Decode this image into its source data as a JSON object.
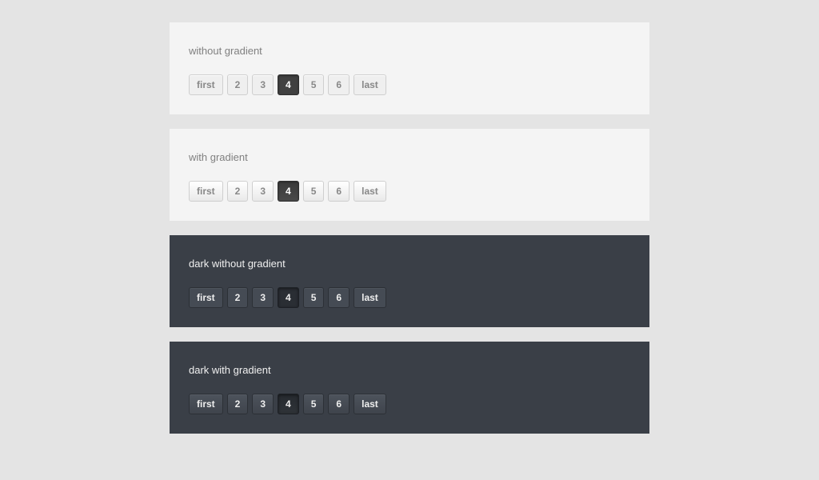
{
  "sections": [
    {
      "variant": "light",
      "title": "without gradient",
      "active": "4"
    },
    {
      "variant": "light grad",
      "title": "with gradient",
      "active": "4"
    },
    {
      "variant": "dark",
      "title": "dark without gradient",
      "active": "4"
    },
    {
      "variant": "dark grad",
      "title": "dark with gradient",
      "active": "4"
    }
  ],
  "pages": [
    "first",
    "2",
    "3",
    "4",
    "5",
    "6",
    "last"
  ]
}
